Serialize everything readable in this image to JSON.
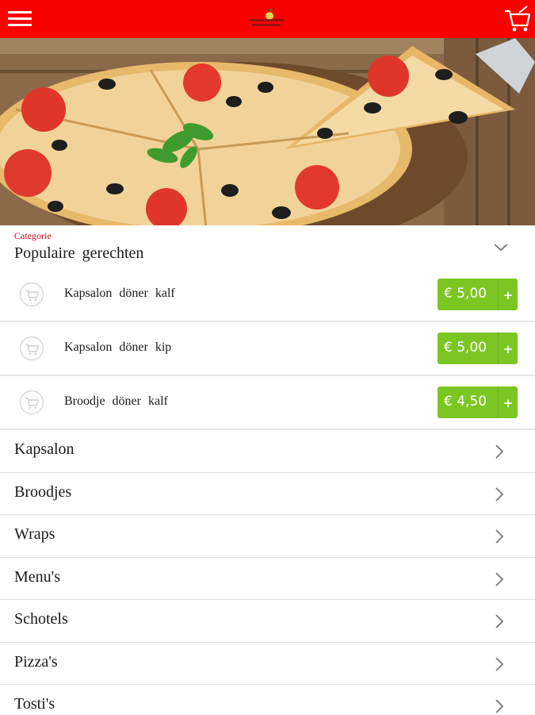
{
  "header": {
    "menu_icon": "hamburger-menu-icon",
    "logo_icon": "restaurant-logo",
    "cart_icon": "shopping-cart-icon",
    "bar_color": "#fb0000"
  },
  "hero": {
    "image": "pizza-photo"
  },
  "category": {
    "label": "Categorie",
    "title": "Populaire gerechten",
    "toggle_icon": "chevron-down-icon"
  },
  "products": [
    {
      "name": "Kapsalon döner kalf",
      "price": "€ 5,00",
      "add": "+"
    },
    {
      "name": "Kapsalon döner kip",
      "price": "€ 5,00",
      "add": "+"
    },
    {
      "name": "Broodje döner kalf",
      "price": "€ 4,50",
      "add": "+"
    }
  ],
  "categories": [
    {
      "label": "Kapsalon"
    },
    {
      "label": "Broodjes"
    },
    {
      "label": "Wraps"
    },
    {
      "label": "Menu's"
    },
    {
      "label": "Schotels"
    },
    {
      "label": "Pizza's"
    },
    {
      "label": "Tosti's"
    }
  ],
  "colors": {
    "accent": "#d0021b",
    "price_button": "#7cc624"
  }
}
